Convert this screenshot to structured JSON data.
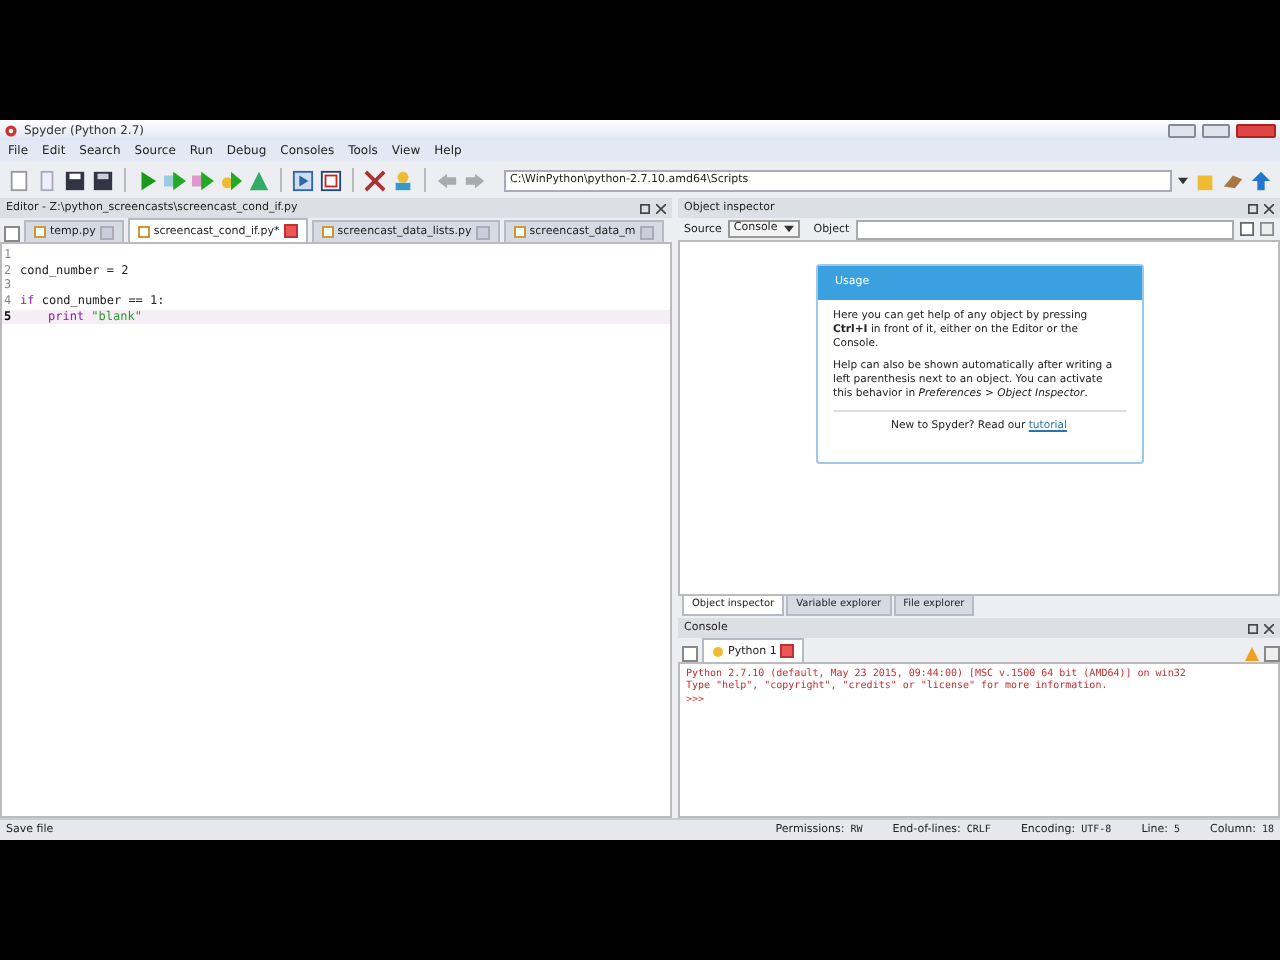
{
  "window": {
    "title": "Spyder (Python 2.7)"
  },
  "menu": [
    "File",
    "Edit",
    "Search",
    "Source",
    "Run",
    "Debug",
    "Consoles",
    "Tools",
    "View",
    "Help"
  ],
  "path_field": {
    "value": "C:\\WinPython\\python-2.7.10.amd64\\Scripts"
  },
  "editor": {
    "title": "Editor - Z:\\python_screencasts\\screencast_cond_if.py",
    "tabs": [
      {
        "label": "temp.py",
        "selected": false
      },
      {
        "label": "screencast_cond_if.py*",
        "selected": true
      },
      {
        "label": "screencast_data_lists.py",
        "selected": false
      },
      {
        "label": "screencast_data_m",
        "selected": false
      }
    ],
    "lines": [
      {
        "number": "1",
        "current": false
      },
      {
        "number": "2",
        "current": false,
        "tokens": [
          {
            "kind": "plain",
            "text": "cond_number = 2"
          }
        ]
      },
      {
        "number": "3",
        "current": false
      },
      {
        "number": "4",
        "current": false,
        "tokens": [
          {
            "kind": "keyword",
            "text": "if"
          },
          {
            "kind": "plain",
            "text": " cond_number == 1:"
          }
        ]
      },
      {
        "number": "5",
        "current": true,
        "indented": true,
        "tokens": [
          {
            "kind": "keyword",
            "text": "print"
          },
          {
            "kind": "string",
            "text": " \"blank\""
          }
        ]
      }
    ]
  },
  "object_inspector": {
    "title": "Object inspector",
    "source_label": "Source",
    "source_value": "Console",
    "object_label": "Object",
    "usage": {
      "title": "Usage",
      "paragraphs": [
        "Here you can get help of any object by pressing **Ctrl+I** in front of it, either on the Editor or the Console.",
        "Help can also be shown automatically after writing a left parenthesis next to an object. You can activate this behavior in *Preferences > Object Inspector*."
      ],
      "footer": "New to Spyder? Read our",
      "link": "tutorial"
    }
  },
  "right_tabs": [
    {
      "label": "Object inspector",
      "selected": true
    },
    {
      "label": "Variable explorer",
      "selected": false
    },
    {
      "label": "File explorer",
      "selected": false
    }
  ],
  "console": {
    "title": "Console",
    "tabs": [
      {
        "label": "Python 1",
        "selected": true
      }
    ],
    "output": [
      "Python 2.7.10 (default, May 23 2015, 09:44:00) [MSC v.1500 64 bit (AMD64)] on win32",
      "Type \"help\", \"copyright\", \"credits\" or \"license\" for more information.",
      ">>>"
    ]
  },
  "status_bar": {
    "message": "Save file",
    "fields": [
      {
        "label": "Permissions:",
        "value": "RW"
      },
      {
        "label": "End-of-lines:",
        "value": "CRLF"
      },
      {
        "label": "Encoding:",
        "value": "UTF-8"
      },
      {
        "label": "Line:",
        "value": "5"
      },
      {
        "label": "Column:",
        "value": "18"
      }
    ]
  }
}
